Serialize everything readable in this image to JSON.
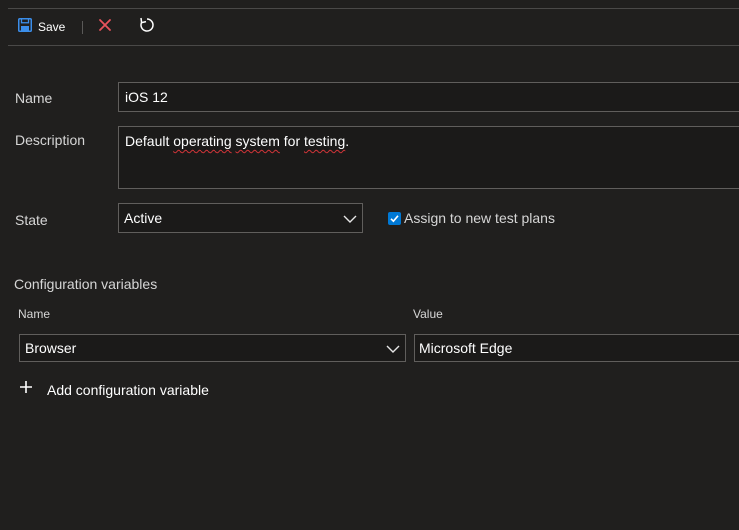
{
  "toolbar": {
    "save_label": "Save",
    "icons": {
      "save": "save-icon",
      "discard": "close-icon",
      "refresh": "refresh-icon"
    },
    "colors": {
      "save": "#3b8eea",
      "discard": "#e8525b",
      "refresh": "#ffffff"
    }
  },
  "form": {
    "name_label": "Name",
    "name_value": "iOS 12",
    "description_label": "Description",
    "description_value": {
      "words": [
        {
          "text": "Default ",
          "misspelled": false
        },
        {
          "text": "operating",
          "misspelled": true
        },
        {
          "text": " ",
          "misspelled": false
        },
        {
          "text": "system",
          "misspelled": true
        },
        {
          "text": " for ",
          "misspelled": false
        },
        {
          "text": "testing",
          "misspelled": true
        },
        {
          "text": ".",
          "misspelled": false
        }
      ]
    },
    "state_label": "State",
    "state_value": "Active",
    "assign_label": "Assign to new test plans",
    "assign_checked": true
  },
  "config": {
    "section_title": "Configuration variables",
    "name_header": "Name",
    "value_header": "Value",
    "row": {
      "name": "Browser",
      "value": "Microsoft Edge"
    },
    "add_label": "Add configuration variable"
  },
  "accent": "#0078d4"
}
